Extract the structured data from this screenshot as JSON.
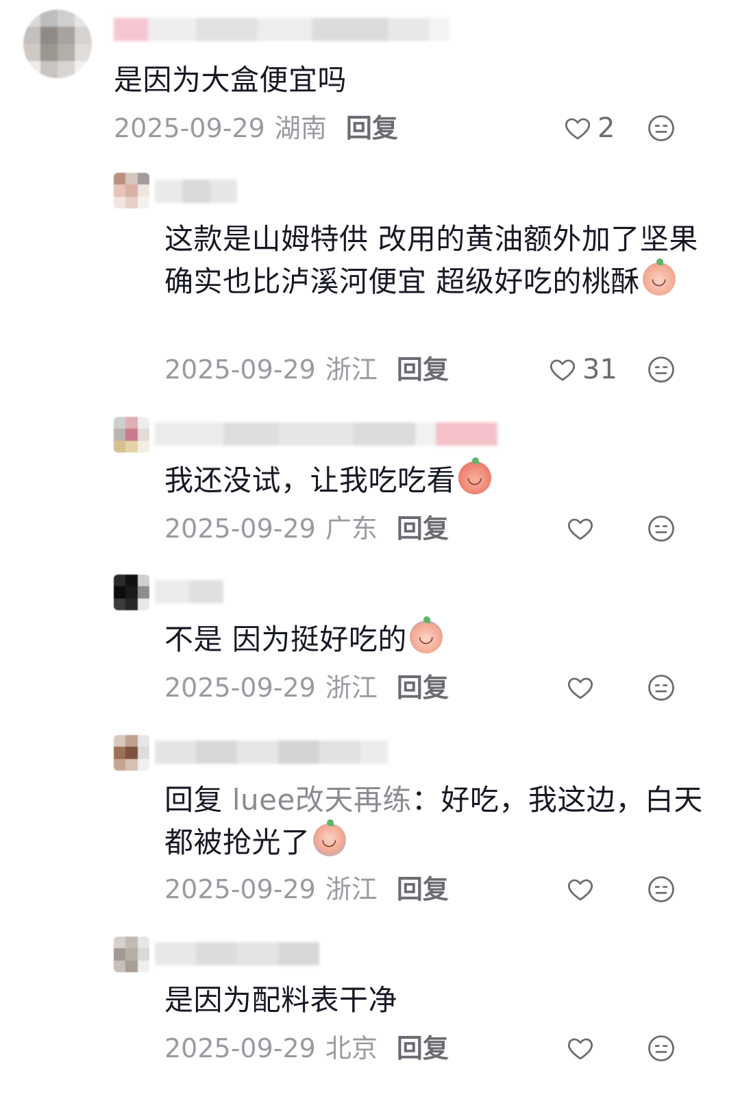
{
  "colors": {
    "text": "#161823",
    "meta": "#9a9ba1",
    "icon": "#6b6c72"
  },
  "comments": [
    {
      "text": "是因为大盒便宜吗",
      "date": "2025-09-29",
      "region": "湖南",
      "reply_label": "回复",
      "likes": "2"
    },
    {
      "text": "这款是山姆特供 改用的黄油额外加了坚果 确实也比泸溪河便宜 超级好吃的桃酥",
      "emoji": "peach-smile-icon",
      "date": "2025-09-29",
      "region": "浙江",
      "reply_label": "回复",
      "likes": "31"
    },
    {
      "text": "我还没试，让我吃吃看",
      "emoji": "peach-shy-icon",
      "date": "2025-09-29",
      "region": "广东",
      "reply_label": "回复",
      "likes": ""
    },
    {
      "text": "不是 因为挺好吃的",
      "emoji": "peach-laugh-cry-icon",
      "date": "2025-09-29",
      "region": "浙江",
      "reply_label": "回复",
      "likes": ""
    },
    {
      "reply_prefix": "回复",
      "reply_target": "luee改天再练",
      "text": "：好吃，我这边，白天都被抢光了",
      "emoji": "peach-sob-icon",
      "date": "2025-09-29",
      "region": "浙江",
      "reply_label": "回复",
      "likes": ""
    },
    {
      "text": "是因为配料表干净",
      "date": "2025-09-29",
      "region": "北京",
      "reply_label": "回复",
      "likes": ""
    }
  ],
  "icons": {
    "like": "heart-outline-icon",
    "dislike": "meh-face-icon"
  }
}
